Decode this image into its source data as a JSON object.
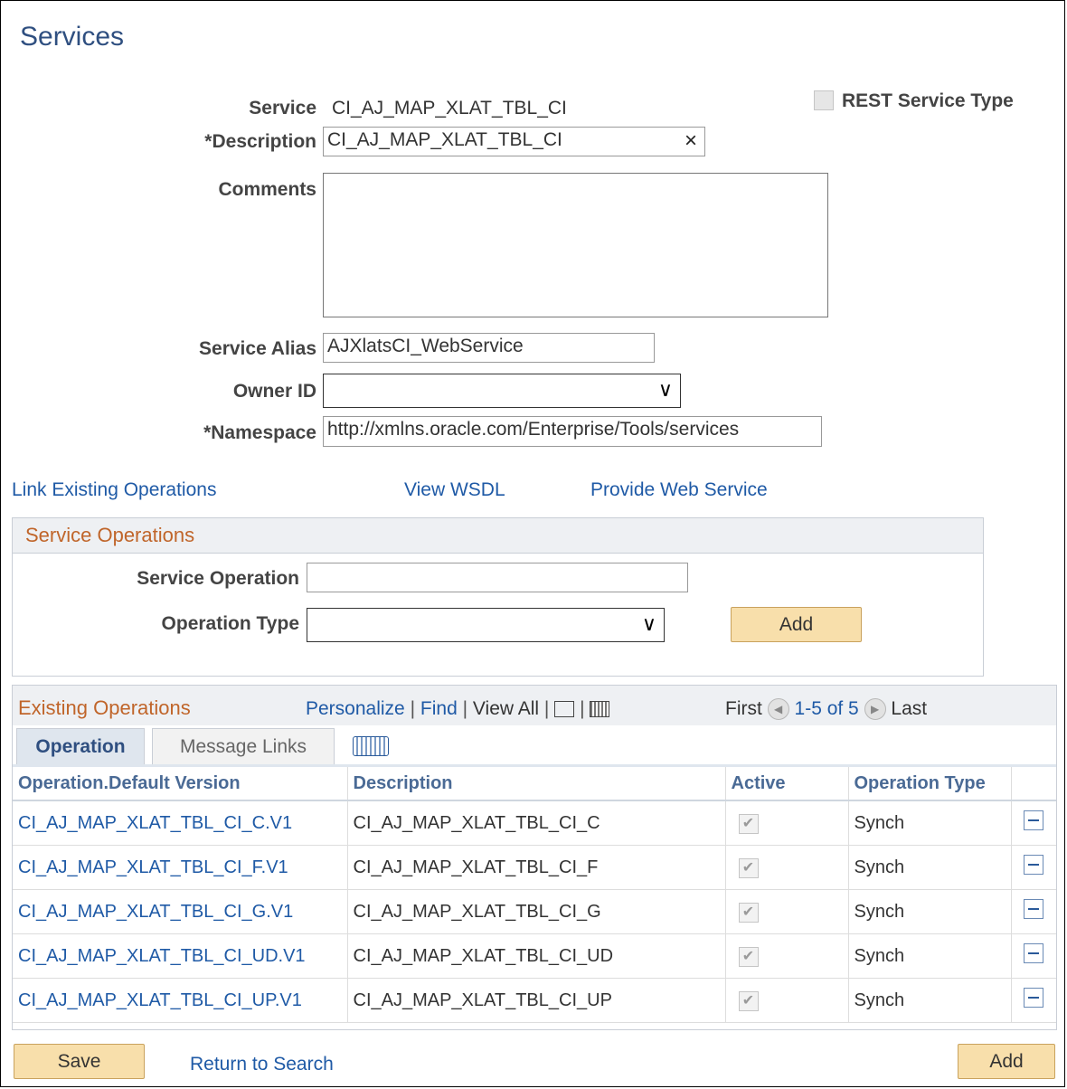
{
  "page": {
    "title": "Services"
  },
  "form": {
    "service_label": "Service",
    "service_value": "CI_AJ_MAP_XLAT_TBL_CI",
    "rest_label": "REST Service Type",
    "description_label": "*Description",
    "description_value": "CI_AJ_MAP_XLAT_TBL_CI",
    "comments_label": "Comments",
    "comments_value": "",
    "alias_label": "Service Alias",
    "alias_value": "AJXlatsCI_WebService",
    "owner_label": "Owner ID",
    "owner_value": "",
    "namespace_label": "*Namespace",
    "namespace_value": "http://xmlns.oracle.com/Enterprise/Tools/services"
  },
  "links": {
    "link_existing": "Link Existing Operations",
    "view_wsdl": "View WSDL",
    "provide_ws": "Provide Web Service"
  },
  "service_ops": {
    "title": "Service Operations",
    "op_label": "Service Operation",
    "op_value": "",
    "type_label": "Operation Type",
    "type_value": "",
    "add_label": "Add"
  },
  "existing": {
    "title": "Existing Operations",
    "personalize": "Personalize",
    "find": "Find",
    "view_all": "View All",
    "first": "First",
    "range": "1-5 of 5",
    "last": "Last",
    "tabs": [
      "Operation",
      "Message Links"
    ],
    "columns": [
      "Operation.Default Version",
      "Description",
      "Active",
      "Operation Type"
    ],
    "rows": [
      {
        "op": "CI_AJ_MAP_XLAT_TBL_CI_C.V1",
        "desc": "CI_AJ_MAP_XLAT_TBL_CI_C",
        "type": "Synch"
      },
      {
        "op": "CI_AJ_MAP_XLAT_TBL_CI_F.V1",
        "desc": "CI_AJ_MAP_XLAT_TBL_CI_F",
        "type": "Synch"
      },
      {
        "op": "CI_AJ_MAP_XLAT_TBL_CI_G.V1",
        "desc": "CI_AJ_MAP_XLAT_TBL_CI_G",
        "type": "Synch"
      },
      {
        "op": "CI_AJ_MAP_XLAT_TBL_CI_UD.V1",
        "desc": "CI_AJ_MAP_XLAT_TBL_CI_UD",
        "type": "Synch"
      },
      {
        "op": "CI_AJ_MAP_XLAT_TBL_CI_UP.V1",
        "desc": "CI_AJ_MAP_XLAT_TBL_CI_UP",
        "type": "Synch"
      }
    ]
  },
  "footer": {
    "save": "Save",
    "return": "Return to Search",
    "add": "Add"
  },
  "colors": {
    "title": "#2f4f80",
    "link": "#1f5aa6",
    "section": "#c0652a",
    "button": "#f8dfab"
  }
}
